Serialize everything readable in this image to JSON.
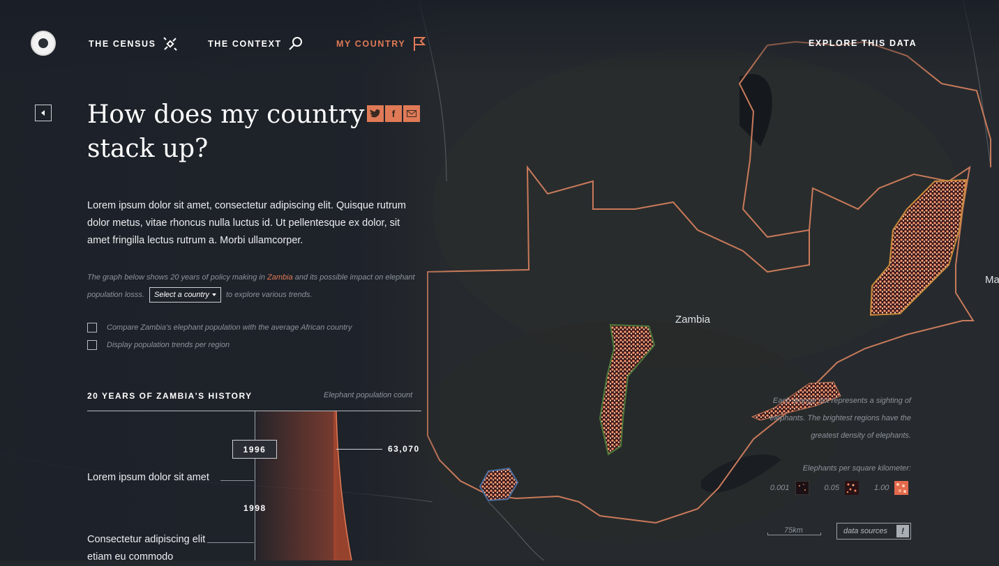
{
  "nav": {
    "census": "THE CENSUS",
    "context": "THE CONTEXT",
    "country": "MY COUNTRY",
    "explore": "EXPLORE THIS DATA"
  },
  "title": "How does my country stack up?",
  "share": {
    "twitter": "t",
    "facebook": "f",
    "email": "✉"
  },
  "intro": "Lorem ipsum dolor sit amet, consectetur adipiscing elit. Quisque rutrum dolor metus, vitae rhoncus nulla luctus id. Ut pellentesque ex dolor, sit amet fringilla lectus rutrum a. Morbi ullamcorper.",
  "note": {
    "before": "The graph below shows 20 years of policy making in ",
    "country": "Zambia",
    "middle": " and its possible impact on elephant population losss.",
    "select": "Select a country",
    "after": " to explore various trends."
  },
  "checks": [
    {
      "label": "Compare Zambia's elephant population with the average African country"
    },
    {
      "label": "Display population trends per region"
    }
  ],
  "history": {
    "title": "20 YEARS OF ZAMBIA'S HISTORY",
    "subtitle": "Elephant population count",
    "year_selected": "1996",
    "year_next": "1998",
    "population": "63,070",
    "events": [
      "Lorem ipsum dolor sit amet",
      "Consectetur adipiscing elit etiam eu commodo"
    ]
  },
  "map": {
    "country_label": "Zambia",
    "edge_label": "Ma",
    "legend_text": "Each orange dot represents a sighting of elephants. The brightest regions have the greatest density of elephants.",
    "legend_title": "Elephants per square kilometer:",
    "legend_levels": [
      "0.001",
      "0.05",
      "1.00"
    ],
    "scale": "75km",
    "data_sources": "data sources",
    "data_sources_icon": "!"
  },
  "colors": {
    "accent": "#e07a56",
    "background": "#24282c",
    "border": "#d9835f"
  }
}
